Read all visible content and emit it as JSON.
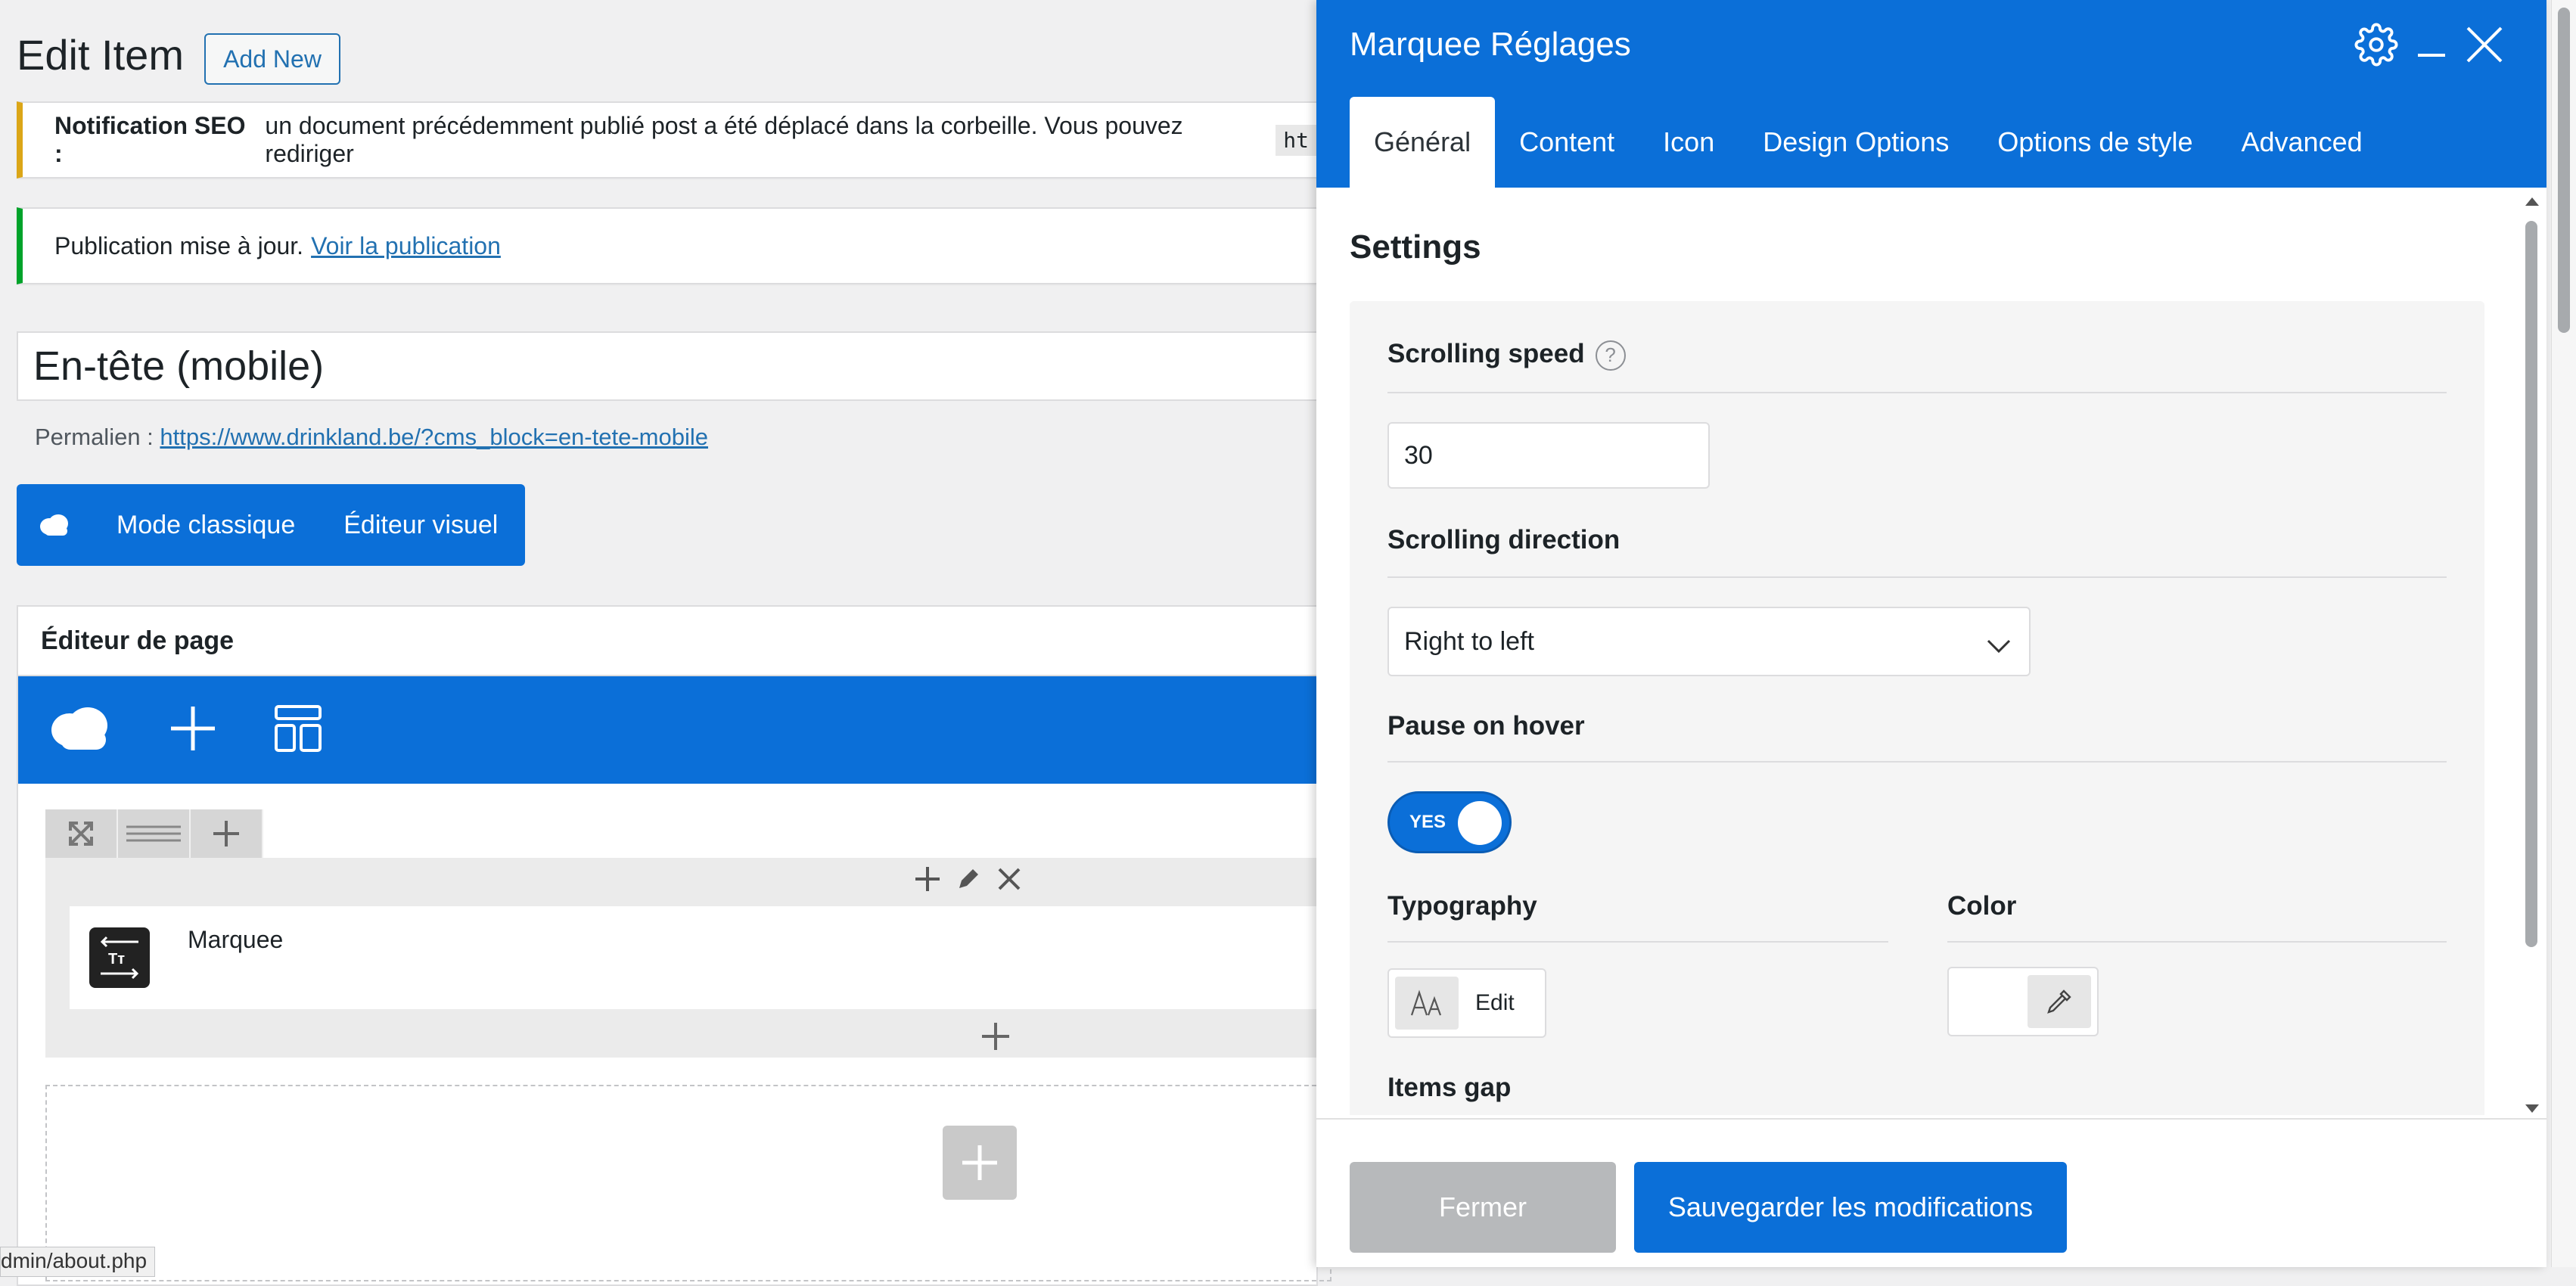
{
  "header": {
    "title": "Edit Item",
    "add_new": "Add New"
  },
  "notices": {
    "seo_strong": "Notification SEO :",
    "seo_text": "un document précédemment publié post a été déplacé dans la corbeille. Vous pouvez rediriger",
    "seo_code": "ht",
    "pub_text": "Publication mise à jour.",
    "pub_link": "Voir la publication"
  },
  "post": {
    "title": "En-tête (mobile)",
    "permalink_label": "Permalien :",
    "permalink_url": "https://www.drinkland.be/?cms_block=en-tete-mobile"
  },
  "mode_bar": {
    "classic": "Mode classique",
    "visual": "Éditeur visuel"
  },
  "page_editor": {
    "title": "Éditeur de page",
    "element_label": "Marquee"
  },
  "status_url": "dmin/about.php",
  "panel": {
    "title": "Marquee Réglages",
    "tabs": [
      "Général",
      "Content",
      "Icon",
      "Design Options",
      "Options de style",
      "Advanced"
    ],
    "settings_title": "Settings",
    "fields": {
      "scrolling_speed": {
        "label": "Scrolling speed",
        "value": "30",
        "help": "?"
      },
      "scrolling_direction": {
        "label": "Scrolling direction",
        "value": "Right to left"
      },
      "pause_on_hover": {
        "label": "Pause on hover",
        "toggle_text": "YES",
        "state": true
      },
      "typography": {
        "label": "Typography",
        "button": "Edit"
      },
      "color": {
        "label": "Color"
      },
      "items_gap": {
        "label": "Items gap"
      }
    },
    "buttons": {
      "close": "Fermer",
      "save": "Sauvegarder les modifications"
    }
  },
  "colors": {
    "accent": "#0b6fd8",
    "warning": "#dba617",
    "success": "#00a32a",
    "link": "#2271b1"
  }
}
